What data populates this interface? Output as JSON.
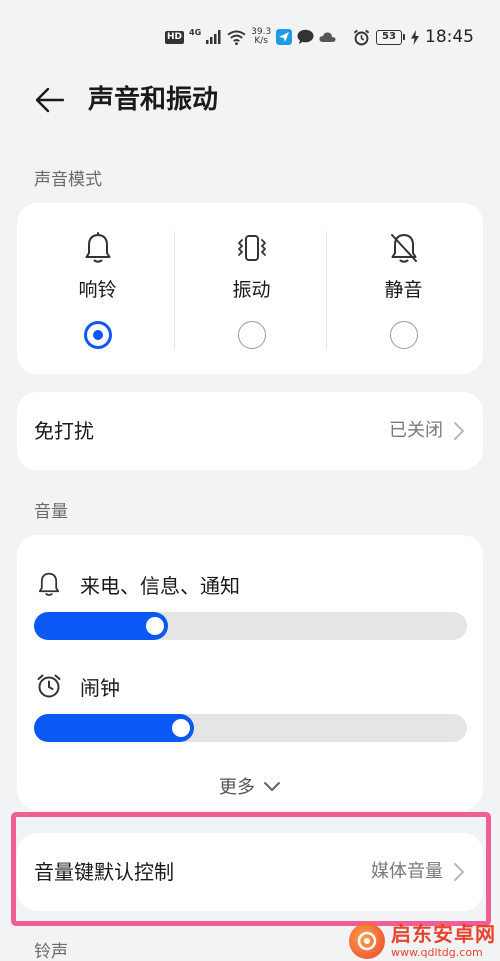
{
  "status_bar": {
    "hd": "HD",
    "network_gen": "4G",
    "speed_value": "39.3",
    "speed_unit": "K/s",
    "battery": "53",
    "time": "18:45"
  },
  "header": {
    "title": "声音和振动"
  },
  "sound_mode": {
    "section_label": "声音模式",
    "options": [
      {
        "label": "响铃",
        "icon": "bell-icon",
        "selected": true
      },
      {
        "label": "振动",
        "icon": "vibrate-icon",
        "selected": false
      },
      {
        "label": "静音",
        "icon": "bell-off-icon",
        "selected": false
      }
    ]
  },
  "do_not_disturb": {
    "title": "免打扰",
    "value": "已关闭"
  },
  "volume": {
    "section_label": "音量",
    "ring": {
      "label": "来电、信息、通知",
      "icon": "bell-icon",
      "level": 0.31
    },
    "alarm": {
      "label": "闹钟",
      "icon": "alarm-clock-icon",
      "level": 0.37
    },
    "more_label": "更多"
  },
  "volume_key": {
    "title": "音量键默认控制",
    "value": "媒体音量"
  },
  "ringtone": {
    "section_label": "铃声"
  },
  "watermark": {
    "title": "启东安卓网",
    "url": "www.qdltdg.com"
  },
  "colors": {
    "accent": "#0a59f7",
    "highlight": "#ef5f93",
    "background": "#f1f3f5"
  }
}
